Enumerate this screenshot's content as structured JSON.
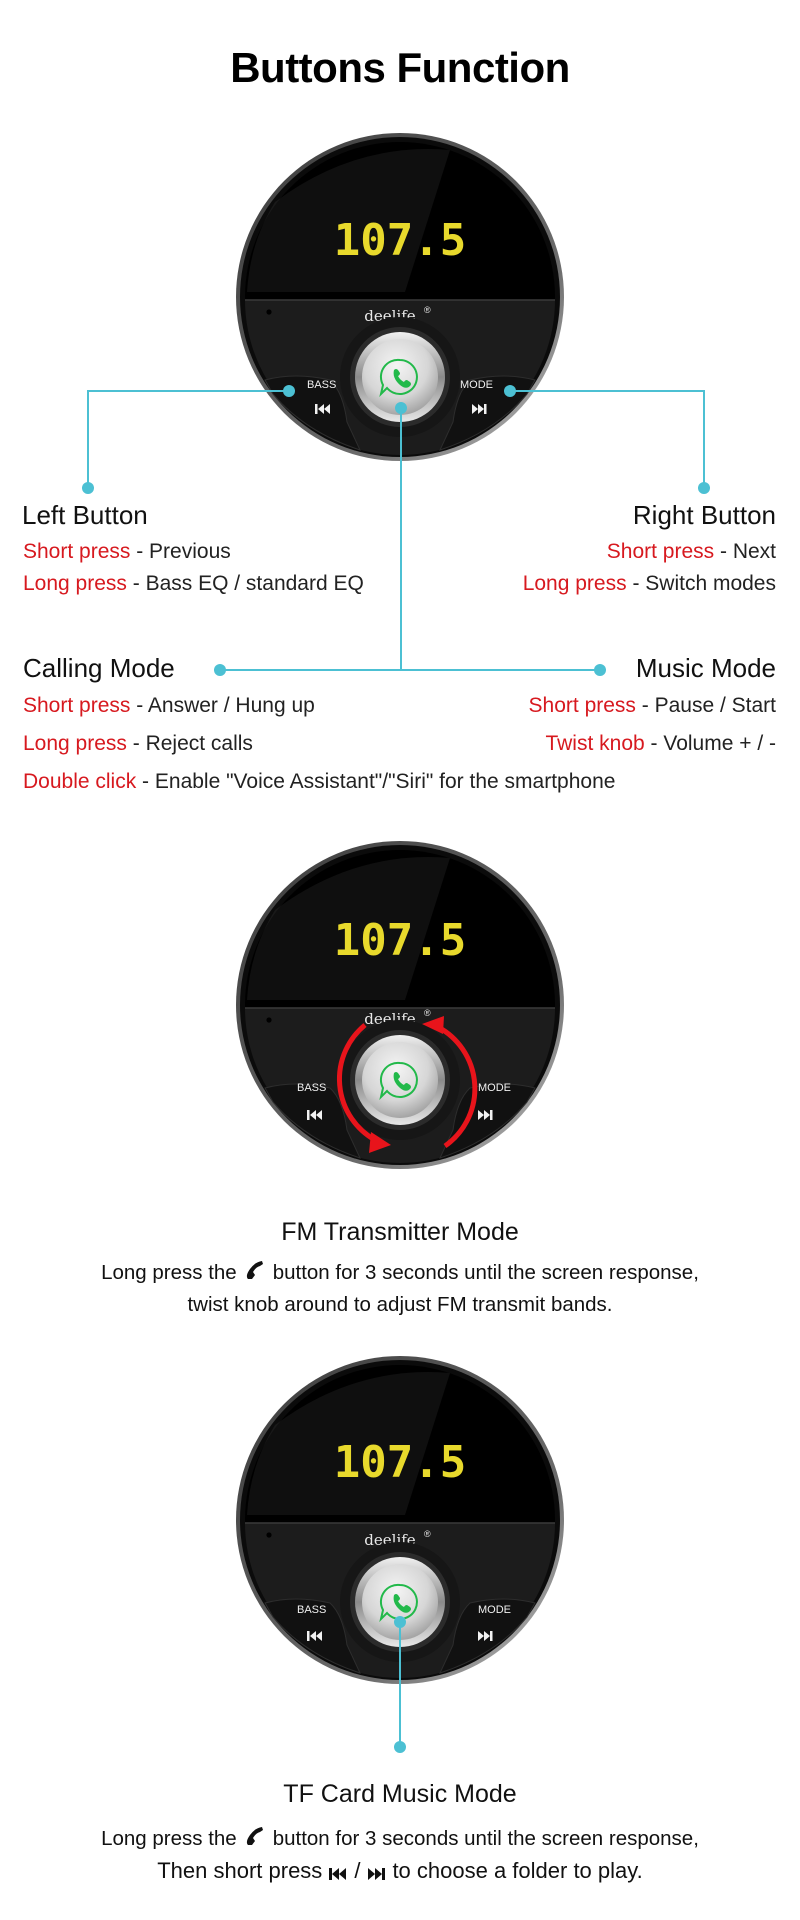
{
  "page": {
    "title": "Buttons Function"
  },
  "device": {
    "display_value": "107.5",
    "brand": "deelife",
    "brand_mark": "®",
    "left_button_label": "BASS",
    "right_button_label": "MODE",
    "left_icon": "skip-previous-icon",
    "right_icon": "skip-next-icon",
    "center_icon": "phone-bubble-icon",
    "display_color": "#e8d92c",
    "center_icon_color": "#22b94a"
  },
  "colors": {
    "accent_red": "#d7191f",
    "connector_cyan": "#4cc0d3"
  },
  "section1": {
    "left_button": {
      "heading": "Left Button",
      "lines": [
        {
          "action": "Short press",
          "desc": " - Previous"
        },
        {
          "action": "Long press",
          "desc": " - Bass EQ / standard EQ"
        }
      ]
    },
    "right_button": {
      "heading": "Right Button",
      "lines": [
        {
          "action": "Short press",
          "desc": " - Next"
        },
        {
          "action": "Long press",
          "desc": " - Switch modes"
        }
      ]
    },
    "calling_mode": {
      "heading": "Calling Mode",
      "lines": [
        {
          "action": "Short press",
          "desc": " - Answer / Hung up"
        },
        {
          "action": "Long press",
          "desc": " - Reject calls"
        },
        {
          "action": "Double click",
          "desc": " - Enable \"Voice Assistant\"/\"Siri\" for the smartphone"
        }
      ]
    },
    "music_mode": {
      "heading": "Music Mode",
      "lines": [
        {
          "action": "Short press",
          "desc": " - Pause / Start"
        },
        {
          "action": "Twist knob",
          "desc": " - Volume + / -"
        }
      ]
    }
  },
  "section2": {
    "heading": "FM Transmitter Mode",
    "line1_before": "Long press the",
    "line1_icon": "phone-handset-icon",
    "line1_after": "button for 3 seconds until the screen response,",
    "line2": "twist knob around to adjust FM transmit bands."
  },
  "section3": {
    "heading": "TF Card Music Mode",
    "line1_before": "Long press the",
    "line1_icon": "phone-handset-icon",
    "line1_after": "button for 3 seconds until the screen response,",
    "line2_before": "Then short press",
    "line2_icon_prev": "skip-previous-icon",
    "line2_sep": "/",
    "line2_icon_next": "skip-next-icon",
    "line2_after": "to choose a folder to play."
  }
}
